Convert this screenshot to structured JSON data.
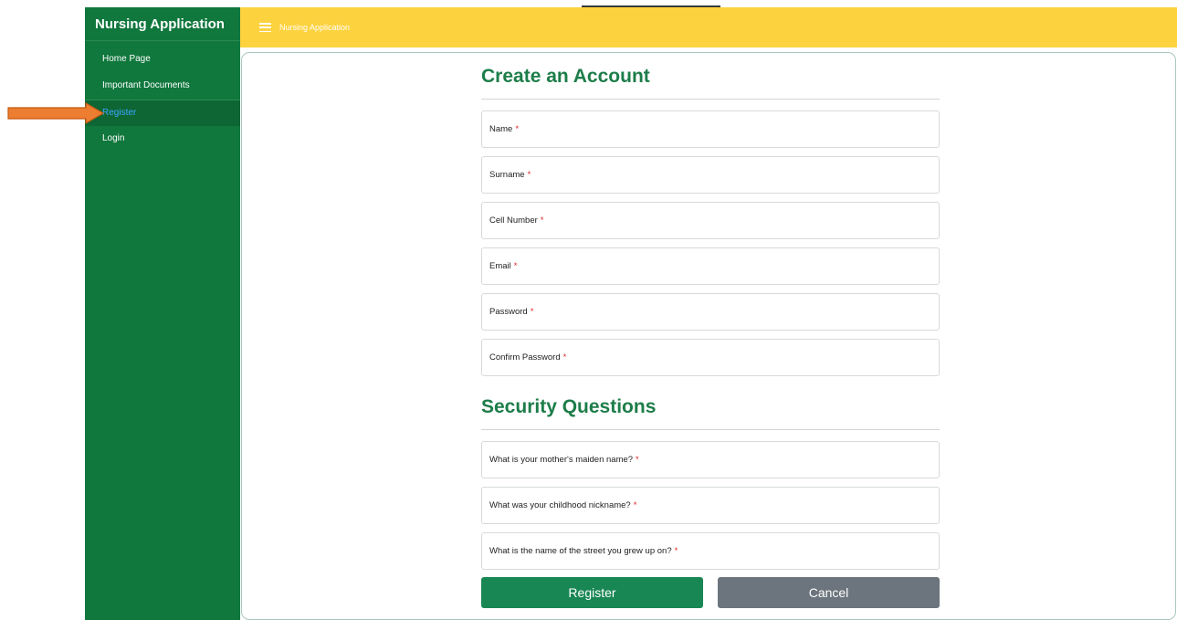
{
  "app": {
    "title": "Nursing Application"
  },
  "sidebar": {
    "items": [
      {
        "label": "Home Page"
      },
      {
        "label": "Important Documents"
      },
      {
        "label": "Register"
      },
      {
        "label": "Login"
      }
    ]
  },
  "topbar": {
    "title": "Nursing Application"
  },
  "account": {
    "heading": "Create an Account",
    "fields": [
      {
        "label": "Name",
        "required": "*"
      },
      {
        "label": "Surname",
        "required": "*"
      },
      {
        "label": "Cell Number",
        "required": "*"
      },
      {
        "label": "Email",
        "required": "*"
      },
      {
        "label": "Password",
        "required": "*"
      },
      {
        "label": "Confirm Password",
        "required": "*"
      }
    ]
  },
  "security": {
    "heading": "Security Questions",
    "fields": [
      {
        "label": "What is your mother's maiden name?",
        "required": "*"
      },
      {
        "label": "What was your childhood nickname?",
        "required": "*"
      },
      {
        "label": "What is the name of the street you grew up on?",
        "required": "*"
      }
    ]
  },
  "actions": {
    "register": "Register",
    "cancel": "Cancel"
  },
  "colors": {
    "sidebar": "#10773d",
    "topbar": "#fdd23f",
    "heading": "#1d7d49",
    "register": "#198754",
    "cancel": "#6c757d",
    "arrow": "#ed7d31"
  }
}
